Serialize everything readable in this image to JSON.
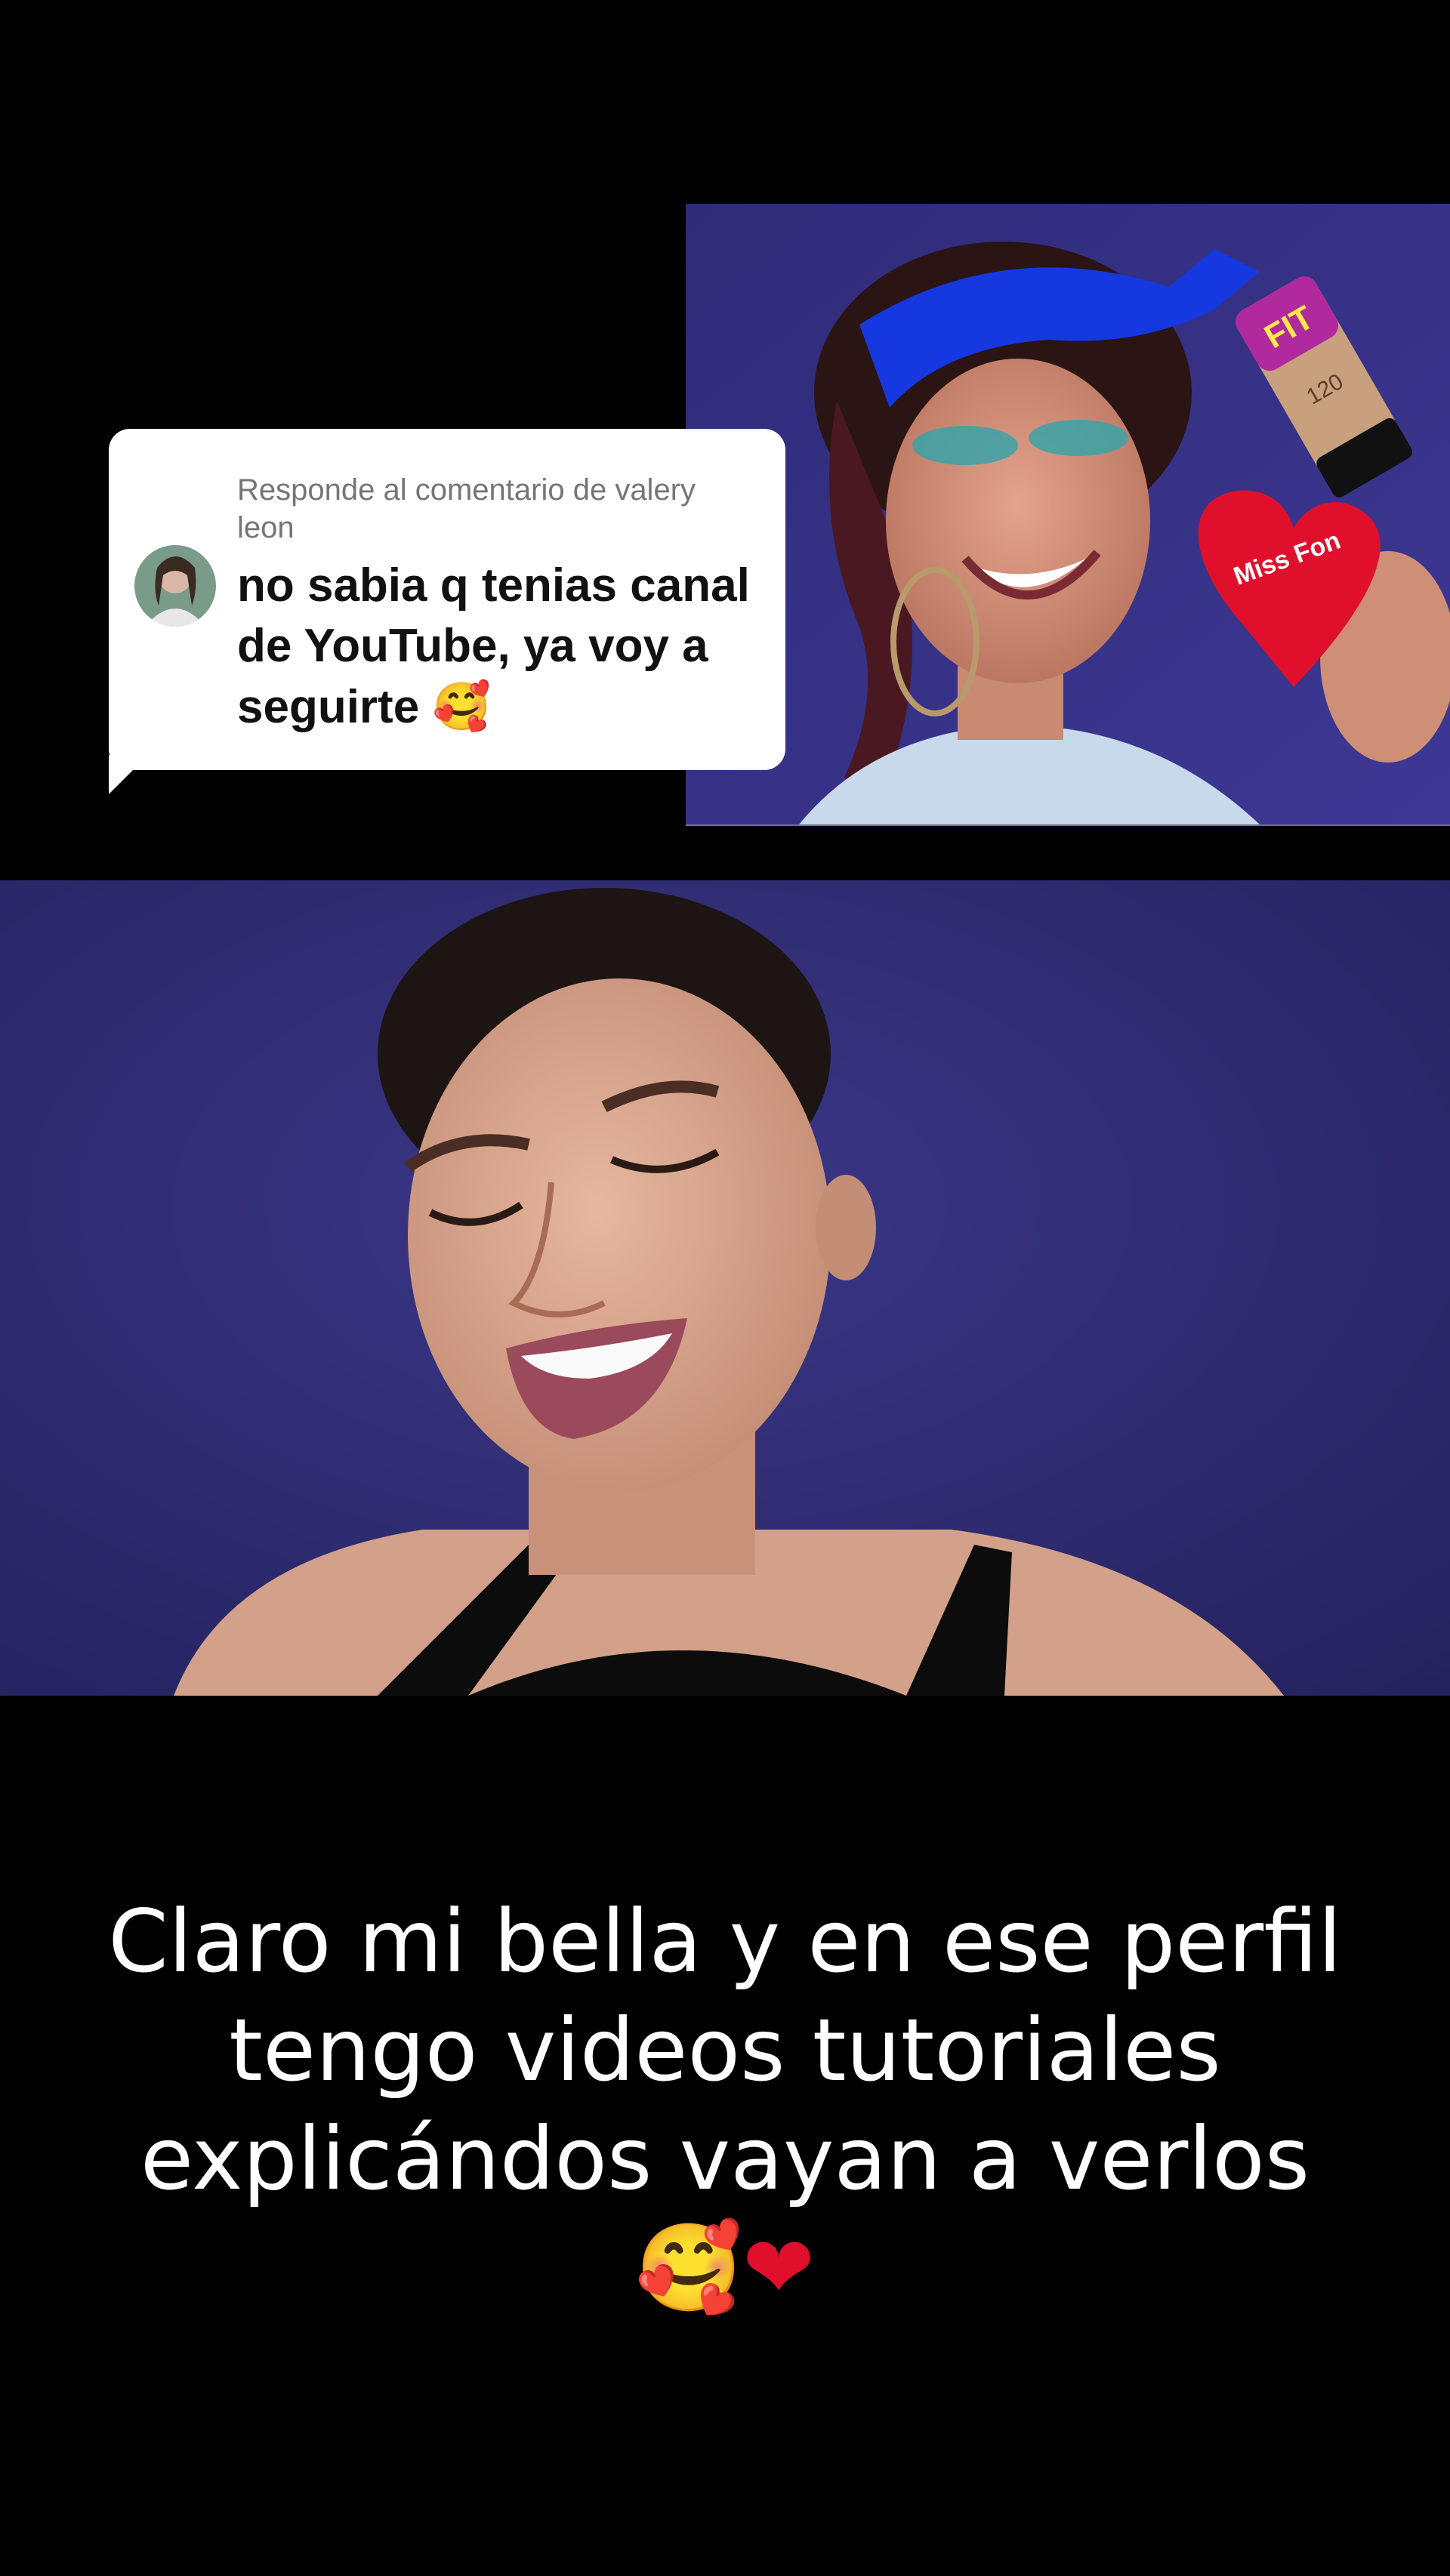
{
  "reply_card": {
    "label": "Responde al comentario de valery leon",
    "comment_text": "no sabia q tenias canal de YouTube, ya voy a seguirte",
    "comment_emoji": "🥰"
  },
  "thumbnail": {
    "product_tube_text": "FIT",
    "product_tube_shade": "120",
    "heart_product_text": "Miss Fon"
  },
  "caption": {
    "line_1": "Claro mi bella y en ese perfil",
    "line_2": "tengo videos tutoriales",
    "line_3": "explicándos vayan a verlos",
    "emoji_1": "🥰",
    "emoji_2": "❤"
  },
  "colors": {
    "background": "#000000",
    "studio_backdrop": "#2c2a6e",
    "bandana_blue": "#1538e0",
    "heart_red": "#e0102c",
    "bubble_white": "#ffffff",
    "label_gray": "#757575"
  }
}
